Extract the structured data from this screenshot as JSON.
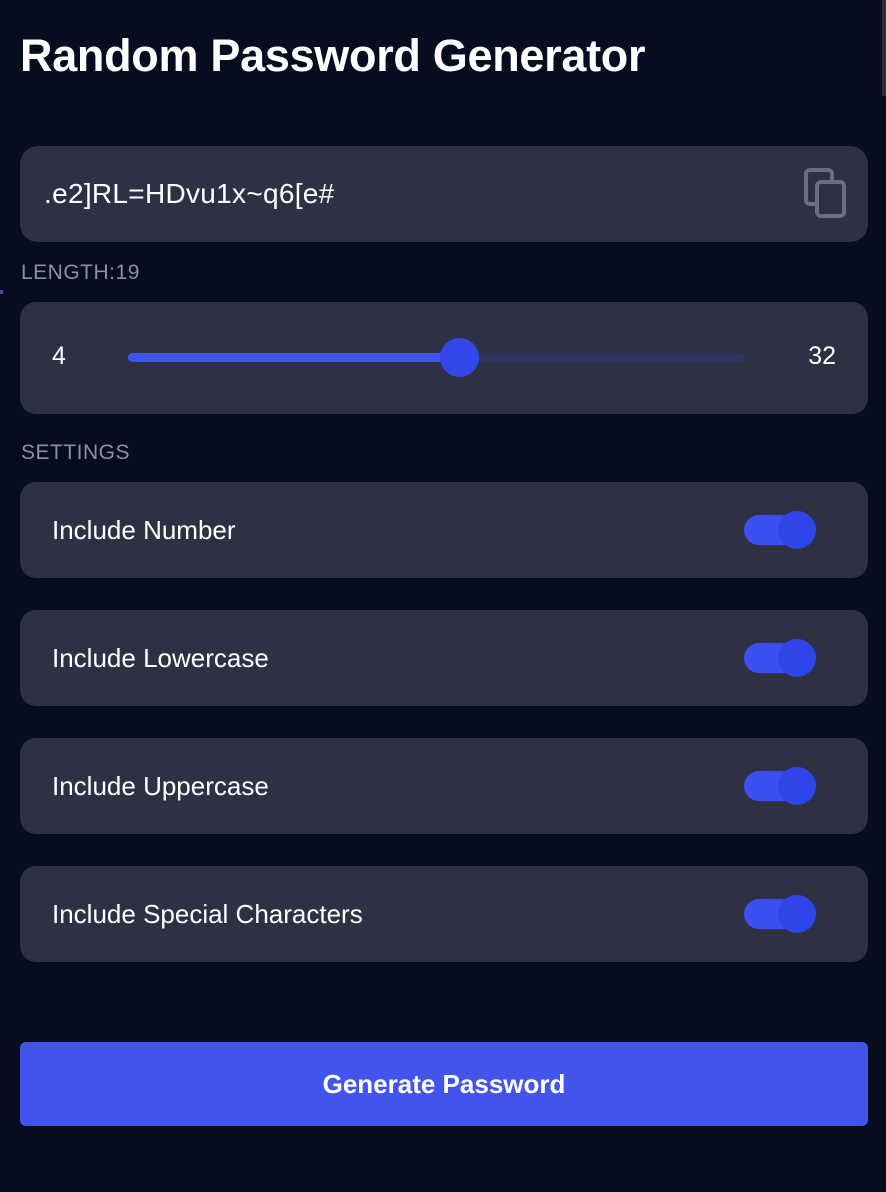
{
  "app": {
    "title": "Random Password Generator"
  },
  "password": {
    "value": ".e2]RL=HDvu1x~q6[e#",
    "copy_icon": "copy-icon"
  },
  "length": {
    "label": "LENGTH:19",
    "min_label": "4",
    "max_label": "32",
    "min": 4,
    "max": 32,
    "value": 19
  },
  "settings": {
    "label": "SETTINGS",
    "items": [
      {
        "label": "Include Number",
        "enabled": true
      },
      {
        "label": "Include Lowercase",
        "enabled": true
      },
      {
        "label": "Include Uppercase",
        "enabled": true
      },
      {
        "label": "Include Special Characters",
        "enabled": true
      }
    ]
  },
  "generate": {
    "label": "Generate Password"
  },
  "colors": {
    "background": "#070c1e",
    "card": "#2e3144",
    "accent": "#4155ec",
    "muted_text": "#8c90a4"
  }
}
